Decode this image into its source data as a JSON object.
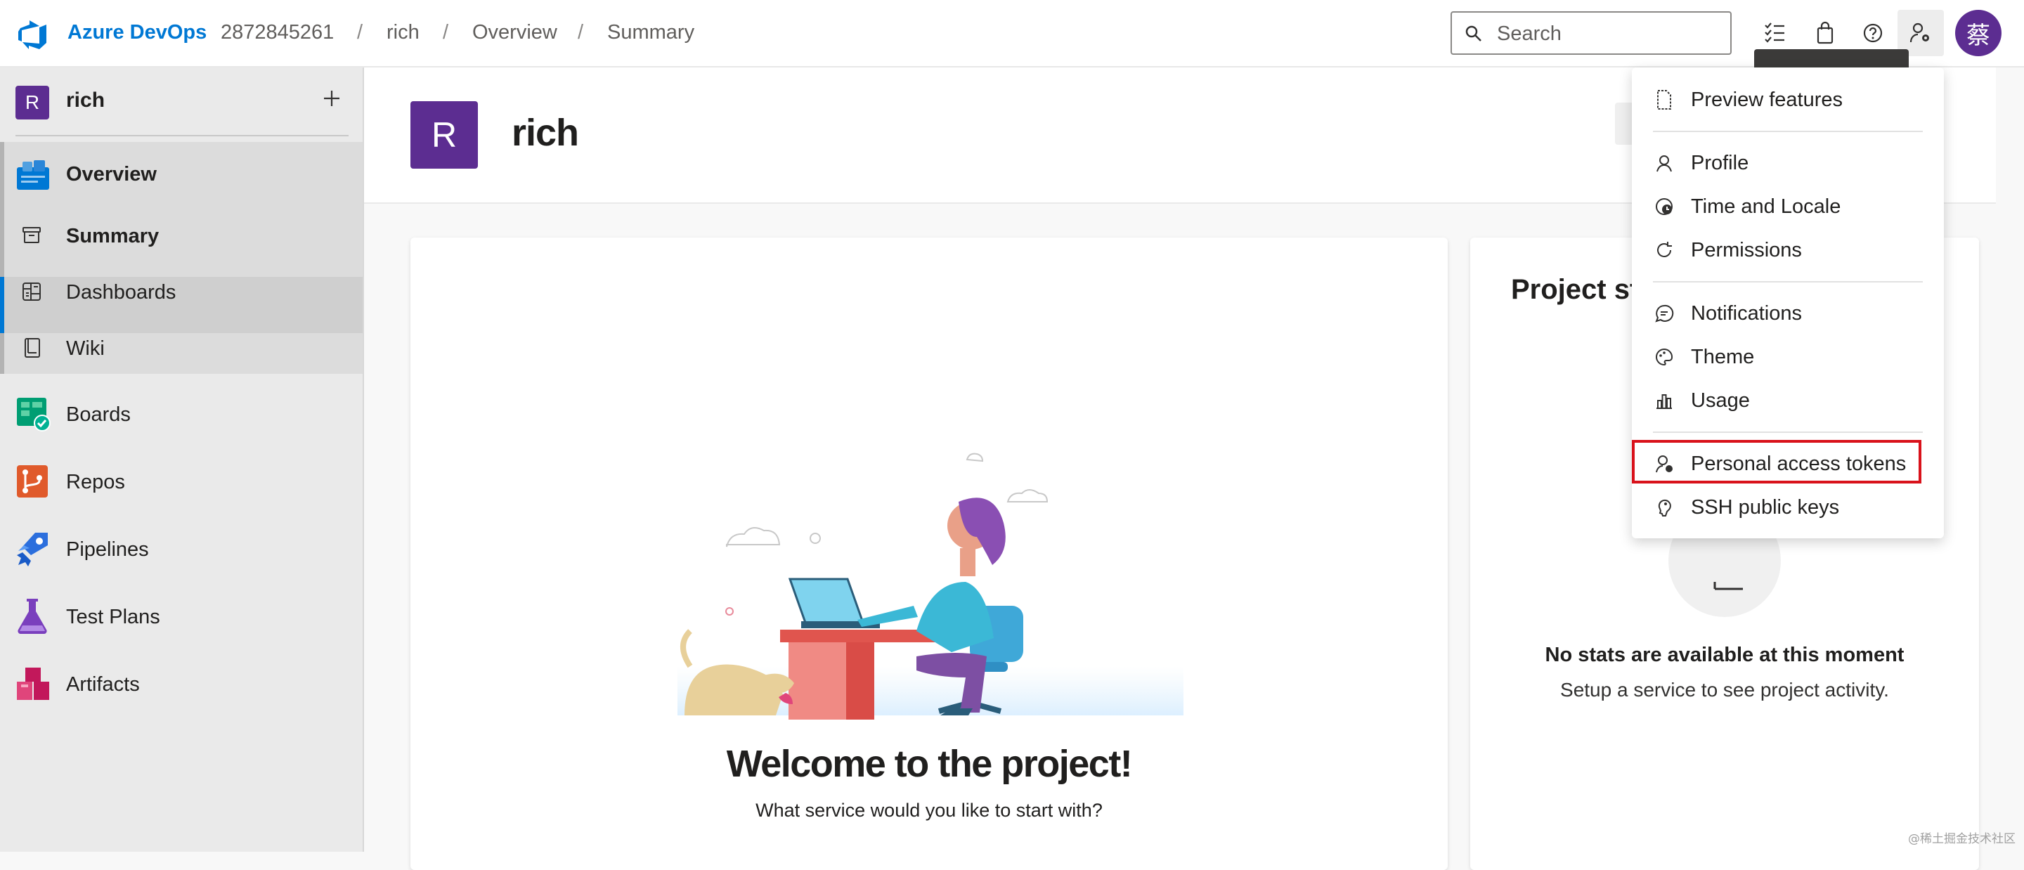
{
  "topbar": {
    "brand": "Azure DevOps",
    "breadcrumbs": [
      "2872845261",
      "rich",
      "Overview",
      "Summary"
    ],
    "separator": "/",
    "search_placeholder": "Search",
    "avatar_initial": "蔡",
    "icons": [
      "task-list-icon",
      "shopping-bag-icon",
      "help-icon",
      "user-settings-icon"
    ]
  },
  "sidebar": {
    "project_initial": "R",
    "project_name": "rich",
    "items": [
      {
        "label": "Overview",
        "icon": "overview-icon"
      },
      {
        "label": "Summary",
        "icon": "summary-icon"
      },
      {
        "label": "Dashboards",
        "icon": "dashboards-icon"
      },
      {
        "label": "Wiki",
        "icon": "wiki-icon"
      },
      {
        "label": "Boards",
        "icon": "boards-icon"
      },
      {
        "label": "Repos",
        "icon": "repos-icon"
      },
      {
        "label": "Pipelines",
        "icon": "pipelines-icon"
      },
      {
        "label": "Test Plans",
        "icon": "test-plans-icon"
      },
      {
        "label": "Artifacts",
        "icon": "artifacts-icon"
      }
    ]
  },
  "main": {
    "project_initial": "R",
    "project_title": "rich",
    "welcome_title": "Welcome to the project!",
    "welcome_sub": "What service would you like to start with?",
    "stats_title": "Project st",
    "stats_empty": "No stats are available at this moment",
    "stats_sub": "Setup a service to see project activity."
  },
  "menu": {
    "items": [
      {
        "label": "Preview features",
        "icon": "preview-features-icon"
      },
      {
        "label": "Profile",
        "icon": "profile-icon"
      },
      {
        "label": "Time and Locale",
        "icon": "time-locale-icon"
      },
      {
        "label": "Permissions",
        "icon": "permissions-icon"
      },
      {
        "label": "Notifications",
        "icon": "notifications-icon"
      },
      {
        "label": "Theme",
        "icon": "theme-icon"
      },
      {
        "label": "Usage",
        "icon": "usage-icon"
      },
      {
        "label": "Personal access tokens",
        "icon": "personal-access-tokens-icon"
      },
      {
        "label": "SSH public keys",
        "icon": "ssh-keys-icon"
      }
    ],
    "highlighted_item": "Personal access tokens"
  },
  "colors": {
    "brand_blue": "#0078d4",
    "project_purple": "#5c2d91",
    "highlight_red": "#d9121b"
  },
  "watermark": "@稀土掘金技术社区"
}
